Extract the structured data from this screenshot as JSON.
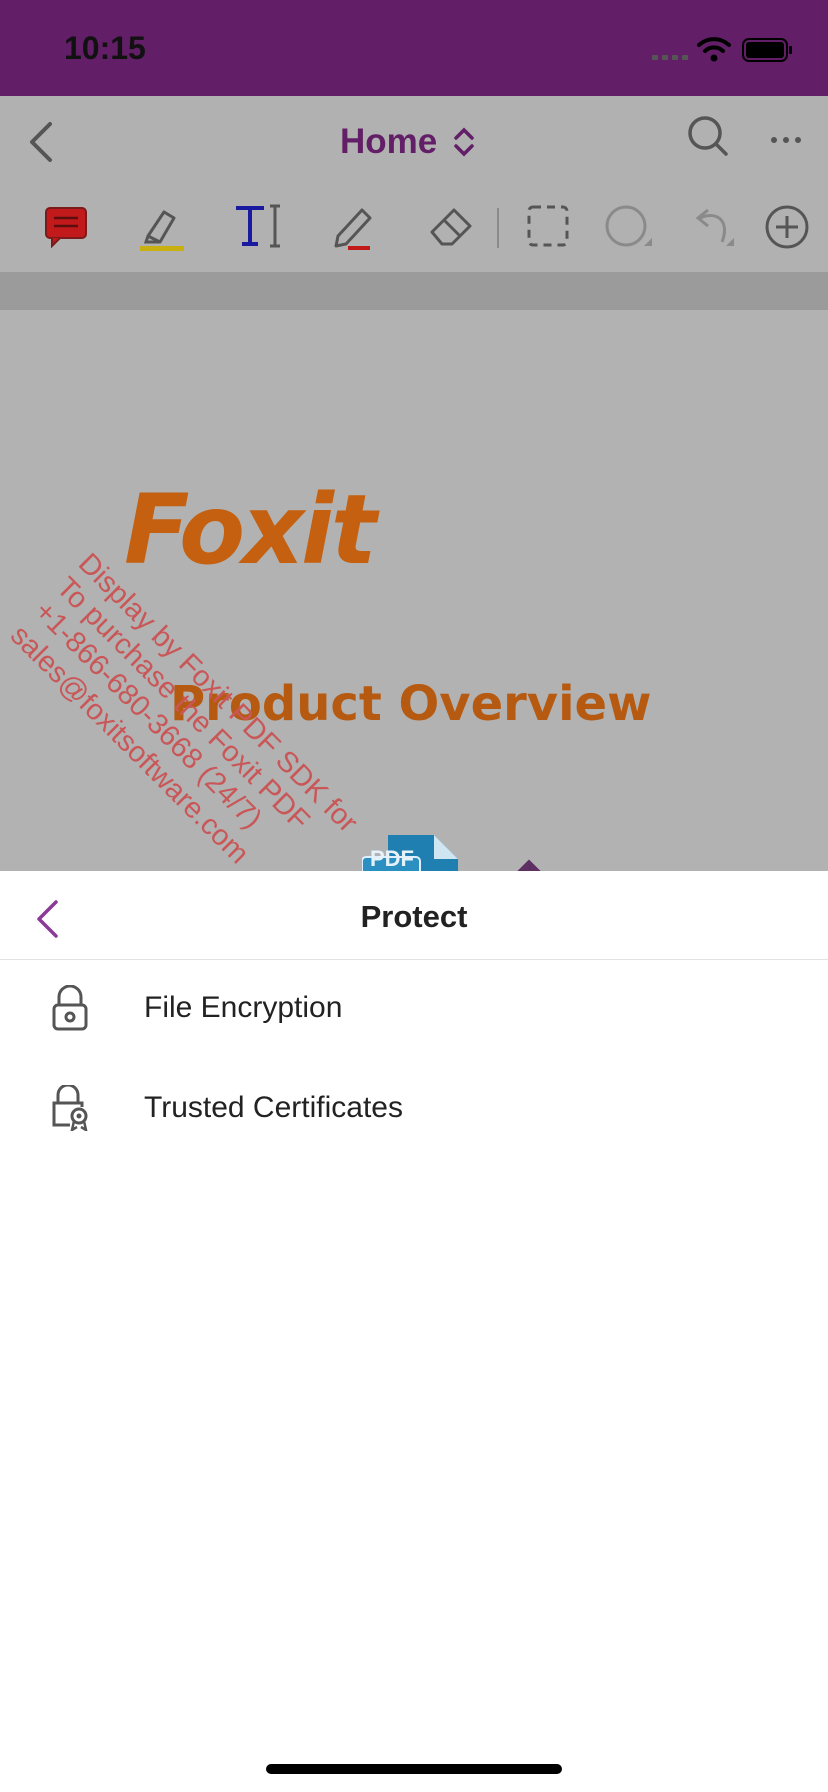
{
  "status_bar": {
    "time": "10:15"
  },
  "app_bar": {
    "title": "Home",
    "icons": [
      "back-icon",
      "search-icon",
      "more-icon"
    ]
  },
  "toolbar": {
    "tools": [
      "note-tool",
      "highlight-tool",
      "text-tool",
      "pencil-tool",
      "eraser-tool",
      "select-tool",
      "shape-tool",
      "undo-tool",
      "add-tool"
    ]
  },
  "document": {
    "logo_text": "Foxit",
    "title": "Product Overview",
    "watermark_lines": [
      "Display by Foxit PDF SDK for",
      "To purchase the Foxit PDF",
      "+1-866-680-3668 (24/7)",
      "sales@foxitsoftware.com"
    ],
    "pdf_badge": "PDF"
  },
  "sheet": {
    "title": "Protect",
    "items": [
      {
        "label": "File Encryption",
        "icon": "lock-icon"
      },
      {
        "label": "Trusted Certificates",
        "icon": "certificate-lock-icon"
      }
    ]
  },
  "colors": {
    "brand": "#621e66",
    "logo": "#c4600f",
    "watermark": "#c95758",
    "dim": "#b1b1b1"
  }
}
